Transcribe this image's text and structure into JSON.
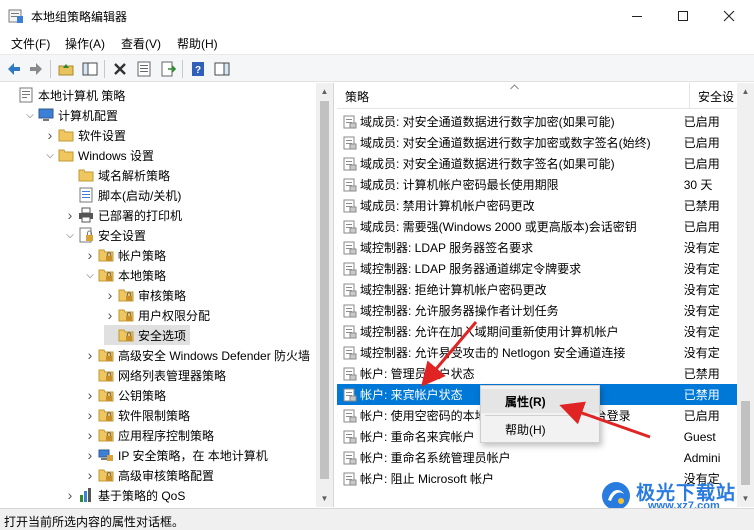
{
  "window": {
    "title": "本地组策略编辑器"
  },
  "menu": [
    "文件(F)",
    "操作(A)",
    "查看(V)",
    "帮助(H)"
  ],
  "tree": [
    {
      "label": "本地计算机 策略",
      "level": 0,
      "exp": "",
      "icon": "computer-policy-icon"
    },
    {
      "label": "计算机配置",
      "level": 1,
      "exp": "open",
      "icon": "computer-icon"
    },
    {
      "label": "软件设置",
      "level": 2,
      "exp": "closed",
      "icon": "folder-icon"
    },
    {
      "label": "Windows 设置",
      "level": 2,
      "exp": "open",
      "icon": "folder-icon"
    },
    {
      "label": "域名解析策略",
      "level": 3,
      "exp": "",
      "icon": "folder-icon"
    },
    {
      "label": "脚本(启动/关机)",
      "level": 3,
      "exp": "",
      "icon": "script-icon"
    },
    {
      "label": "已部署的打印机",
      "level": 3,
      "exp": "closed",
      "icon": "printer-icon"
    },
    {
      "label": "安全设置",
      "level": 3,
      "exp": "open",
      "icon": "security-icon"
    },
    {
      "label": "帐户策略",
      "level": 4,
      "exp": "closed",
      "icon": "lock-folder-icon"
    },
    {
      "label": "本地策略",
      "level": 4,
      "exp": "open",
      "icon": "lock-folder-icon"
    },
    {
      "label": "审核策略",
      "level": 5,
      "exp": "closed",
      "icon": "lock-folder-icon"
    },
    {
      "label": "用户权限分配",
      "level": 5,
      "exp": "closed",
      "icon": "lock-folder-icon"
    },
    {
      "label": "安全选项",
      "level": 5,
      "exp": "",
      "icon": "lock-folder-icon",
      "selected": true
    },
    {
      "label": "高级安全 Windows Defender 防火墙",
      "level": 4,
      "exp": "closed",
      "icon": "lock-folder-icon"
    },
    {
      "label": "网络列表管理器策略",
      "level": 4,
      "exp": "",
      "icon": "lock-folder-icon"
    },
    {
      "label": "公钥策略",
      "level": 4,
      "exp": "closed",
      "icon": "lock-folder-icon"
    },
    {
      "label": "软件限制策略",
      "level": 4,
      "exp": "closed",
      "icon": "lock-folder-icon"
    },
    {
      "label": "应用程序控制策略",
      "level": 4,
      "exp": "closed",
      "icon": "lock-folder-icon"
    },
    {
      "label": "IP 安全策略，在 本地计算机",
      "level": 4,
      "exp": "closed",
      "icon": "ip-security-icon"
    },
    {
      "label": "高级审核策略配置",
      "level": 4,
      "exp": "closed",
      "icon": "lock-folder-icon"
    },
    {
      "label": "基于策略的 QoS",
      "level": 3,
      "exp": "closed",
      "icon": "chart-icon"
    }
  ],
  "list": {
    "col_policy": "策略",
    "col_setting": "安全设",
    "rows": [
      {
        "name": "域成员: 对安全通道数据进行数字加密(如果可能)",
        "value": "已启用"
      },
      {
        "name": "域成员: 对安全通道数据进行数字加密或数字签名(始终)",
        "value": "已启用"
      },
      {
        "name": "域成员: 对安全通道数据进行数字签名(如果可能)",
        "value": "已启用"
      },
      {
        "name": "域成员: 计算机帐户密码最长使用期限",
        "value": "30 天"
      },
      {
        "name": "域成员: 禁用计算机帐户密码更改",
        "value": "已禁用"
      },
      {
        "name": "域成员: 需要强(Windows 2000 或更高版本)会话密钥",
        "value": "已启用"
      },
      {
        "name": "域控制器: LDAP 服务器签名要求",
        "value": "没有定"
      },
      {
        "name": "域控制器: LDAP 服务器通道绑定令牌要求",
        "value": "没有定"
      },
      {
        "name": "域控制器: 拒绝计算机帐户密码更改",
        "value": "没有定"
      },
      {
        "name": "域控制器: 允许服务器操作者计划任务",
        "value": "没有定"
      },
      {
        "name": "域控制器:  允许在加入域期间重新使用计算机帐户",
        "value": "没有定"
      },
      {
        "name": "域控制器:  允许易受攻击的 Netlogon 安全通道连接",
        "value": "没有定"
      },
      {
        "name": "帐户: 管理员帐户状态",
        "value": "已禁用"
      },
      {
        "name": "帐户: 来宾帐户状态",
        "value": "已禁用",
        "selected": true
      },
      {
        "name": "帐户: 使用空密码的本地帐户只允许进行控制台登录",
        "value": "已启用"
      },
      {
        "name": "帐户: 重命名来宾帐户",
        "value": "Guest"
      },
      {
        "name": "帐户: 重命名系统管理员帐户",
        "value": "Admini"
      },
      {
        "name": "帐户: 阻止 Microsoft 帐户",
        "value": "没有定"
      }
    ]
  },
  "context_menu": {
    "properties": "属性(R)",
    "help": "帮助(H)"
  },
  "status": "打开当前所选内容的属性对话框。",
  "watermark": {
    "main": "极光下载站",
    "sub": "www.xz7.com"
  },
  "colors": {
    "selection": "#0078d7",
    "arrow": "#e02424",
    "watermark": "#2a7be0"
  }
}
